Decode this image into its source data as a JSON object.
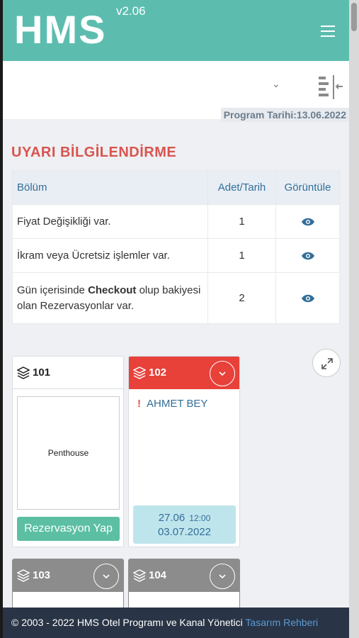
{
  "header": {
    "logo": "HMS",
    "version": "v2.06"
  },
  "program_date": "Program Tarihi:13.06.2022",
  "warnings": {
    "title": "UYARI BİLGİLENDİRME",
    "columns": [
      "Bölüm",
      "Adet/Tarih",
      "Görüntüle"
    ],
    "rows": [
      {
        "text": "Fiyat Değişikliği var.",
        "count": "1"
      },
      {
        "text": "İkram veya Ücretsiz işlemler var.",
        "count": "1"
      },
      {
        "text_before": "Gün içerisinde ",
        "text_bold": "Checkout",
        "text_after": " olup bakiyesi olan Rezervasyonlar var.",
        "count": "2"
      }
    ]
  },
  "rooms": [
    {
      "number": "101",
      "type": "Penthouse",
      "action": "Rezervasyon Yap"
    },
    {
      "number": "102",
      "guest": "AHMET BEY",
      "checkin": "27.06",
      "checkin_time": "12:00",
      "checkout": "03.07.2022"
    },
    {
      "number": "103"
    },
    {
      "number": "104"
    }
  ],
  "colors": {
    "teal": "#5cbdaf",
    "red": "#e8413a",
    "gray": "#8c8c8c",
    "footer": "#293446"
  },
  "footer": {
    "text": "© 2003 - 2022 HMS Otel Programı ve Kanal Yönetici ",
    "link": "Tasarım Rehberi"
  }
}
